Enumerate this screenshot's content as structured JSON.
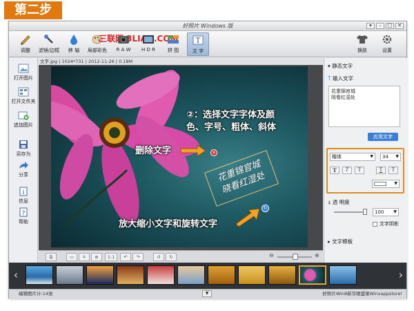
{
  "banner": "第二步",
  "window": {
    "title": "好照片 Windows 版",
    "controls": [
      "▾",
      "–",
      "□",
      "✕"
    ]
  },
  "toolbar": {
    "items": [
      {
        "label": "调整",
        "icon": "pencil-icon"
      },
      {
        "label": "滤镜/边框",
        "icon": "brush-icon"
      },
      {
        "label": "移 轴",
        "icon": "drop-icon"
      },
      {
        "label": "局部彩色",
        "icon": "palette-icon"
      },
      {
        "label": "R A W",
        "icon": "raw-icon"
      },
      {
        "label": "H D R",
        "icon": "hdr-icon"
      },
      {
        "label": "拼 图",
        "icon": "collage-icon"
      },
      {
        "label": "文 字",
        "icon": "text-icon"
      }
    ],
    "active_index": 7,
    "watermark": "三联网 3LIAN.COM",
    "skin_label": "换肤",
    "settings_label": "设置"
  },
  "sidebar": {
    "items": [
      {
        "label": "打开图片",
        "icon": "open-image-icon"
      },
      {
        "label": "打开文件夹",
        "icon": "open-folder-icon"
      },
      {
        "label": "追加图片",
        "icon": "add-image-icon"
      },
      {
        "label": "另存为",
        "icon": "save-as-icon"
      },
      {
        "label": "分享",
        "icon": "share-icon"
      },
      {
        "label": "信息",
        "icon": "info-icon"
      },
      {
        "label": "帮助",
        "icon": "help-icon"
      }
    ]
  },
  "infobar": "文字.jpg | 1024*731 | 2012-11-26 | 0.18M",
  "annotations": {
    "step": "②：选择文字字体及颜",
    "step2": "色、字号、粗体、斜体",
    "delete": "删除文字",
    "scale_rotate": "放大缩小文字和旋转文字"
  },
  "overlay_text": {
    "line1": "花重锦官城",
    "line2": "晓看红湿处"
  },
  "bottom_tools": [
    "⧉",
    "▭",
    "⌗",
    "⊕",
    "1:1",
    "↶",
    "↷",
    "↺",
    "↻"
  ],
  "panel": {
    "section_title": "静态文字",
    "input_label": "输入文字",
    "input_line1": "花重锦官城",
    "input_line2": "晓看红湿处",
    "apply_label": "应用文字",
    "font_name": "楷体",
    "font_size": "34",
    "format_buttons": [
      "T",
      "T",
      "T",
      "T",
      "T"
    ],
    "opacity_label": "透 明度",
    "opacity_value": "100",
    "opacity_fraction": 1.0,
    "shadow_label": "文字阴影",
    "template_label": "文字模板"
  },
  "status": {
    "left": "编辑图片计:14张",
    "right": "好照片Win8新华眼盟录Winxappstore!"
  },
  "colors": {
    "accent_orange": "#e07a10",
    "panel_highlight": "#e08a18",
    "apply_blue": "#3b7fd4"
  }
}
